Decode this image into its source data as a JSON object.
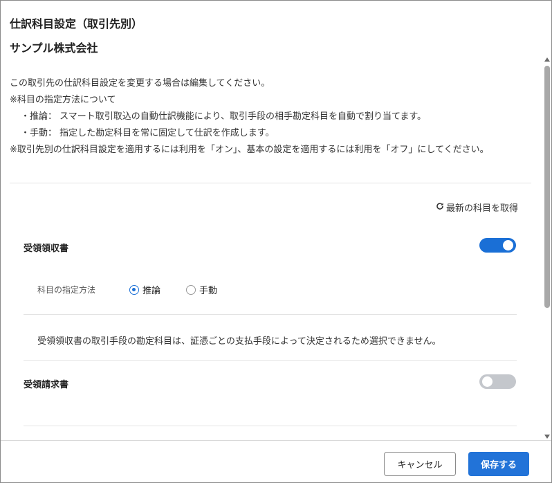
{
  "dialog": {
    "title": "仕訳科目設定（取引先別）",
    "company_name": "サンプル株式会社",
    "description": {
      "line1": "この取引先の仕訳科目設定を変更する場合は編集してください。",
      "line2": "※科目の指定方法について",
      "line3": "・推論： スマート取引取込の自動仕訳機能により、取引手段の相手勘定科目を自動で割り当てます。",
      "line4": "・手動： 指定した勘定科目を常に固定して仕訳を作成します。",
      "line5": "※取引先別の仕訳科目設定を適用するには利用を「オン」、基本の設定を適用するには利用を「オフ」にしてください。"
    }
  },
  "refresh": {
    "label": "最新の科目を取得",
    "icon": "refresh-icon"
  },
  "sections": {
    "receipt": {
      "label": "受領領収書",
      "enabled": true,
      "method_label": "科目の指定方法",
      "options": {
        "inference": "推論",
        "manual": "手動"
      },
      "selected": "推論",
      "note": "受領領収書の取引手段の勘定科目は、証憑ごとの支払手段によって決定されるため選択できません。"
    },
    "invoice": {
      "label": "受領請求書",
      "enabled": false
    }
  },
  "footer": {
    "cancel_label": "キャンセル",
    "save_label": "保存する"
  },
  "colors": {
    "accent": "#1a6fd6",
    "toggle_off": "#c4c7cc",
    "save_button": "#2273d8"
  }
}
